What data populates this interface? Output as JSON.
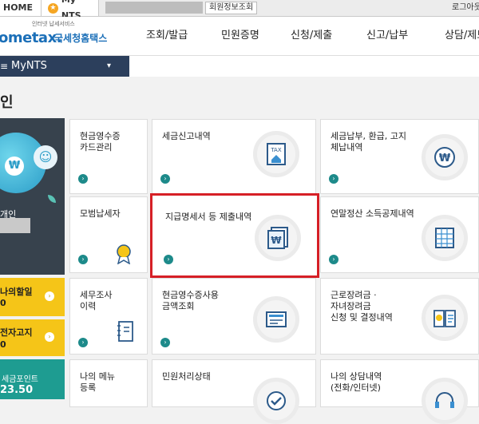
{
  "topbar": {
    "home_tab": "HOME",
    "mynts_tab": "My NTS",
    "member_button": "회원정보조회",
    "logout": "로그아웃"
  },
  "header": {
    "logo_tagline": "인터넷 납세서비스",
    "logo_main": "ometax.",
    "logo_korean": "국세청홈택스",
    "menu": [
      "조회/발급",
      "민원증명",
      "신청/제출",
      "신고/납부",
      "상담/제보"
    ]
  },
  "mynts_bar": {
    "label": "MyNTS",
    "caret": "▾"
  },
  "page_title": "인",
  "profile": {
    "label": "개인"
  },
  "left_cards": [
    {
      "label": "나의할일",
      "value": "0"
    },
    {
      "label": "전자고지",
      "value": "0"
    }
  ],
  "teal_card": {
    "label": "세금포인트",
    "value": "23.50"
  },
  "cards": [
    {
      "label": "현금영수증\n카드관리",
      "icon": "none"
    },
    {
      "label": "세금신고내역",
      "icon": "tax-document-icon"
    },
    {
      "label": "세금납부, 환급, 고지\n체납내역",
      "icon": "won-coin-icon"
    },
    {
      "label": "모범납세자",
      "icon": "medal-icon"
    },
    {
      "label": "지급명세서 등 제출내역",
      "icon": "won-document-icon"
    },
    {
      "label": "연말정산 소득공제내역",
      "icon": "spreadsheet-icon"
    },
    {
      "label": "세무조사\n이력",
      "icon": "notebook-icon"
    },
    {
      "label": "현금영수증사용\n금액조회",
      "icon": "receipt-icon"
    },
    {
      "label": "근로장려금 ·\n자녀장려금\n신청 및 결정내역",
      "icon": "won-book-icon"
    },
    {
      "label": "나의 메뉴\n등록",
      "icon": "none"
    },
    {
      "label": "민원처리상태",
      "icon": "check-icon"
    },
    {
      "label": "나의 상담내역\n(전화/인터넷)",
      "icon": "headset-icon"
    }
  ],
  "colors": {
    "brand": "#1b6fb8",
    "nav_dark": "#2c3f5c",
    "highlight": "#d61f26",
    "accent_yellow": "#f5c518",
    "accent_teal": "#1e9c91"
  }
}
